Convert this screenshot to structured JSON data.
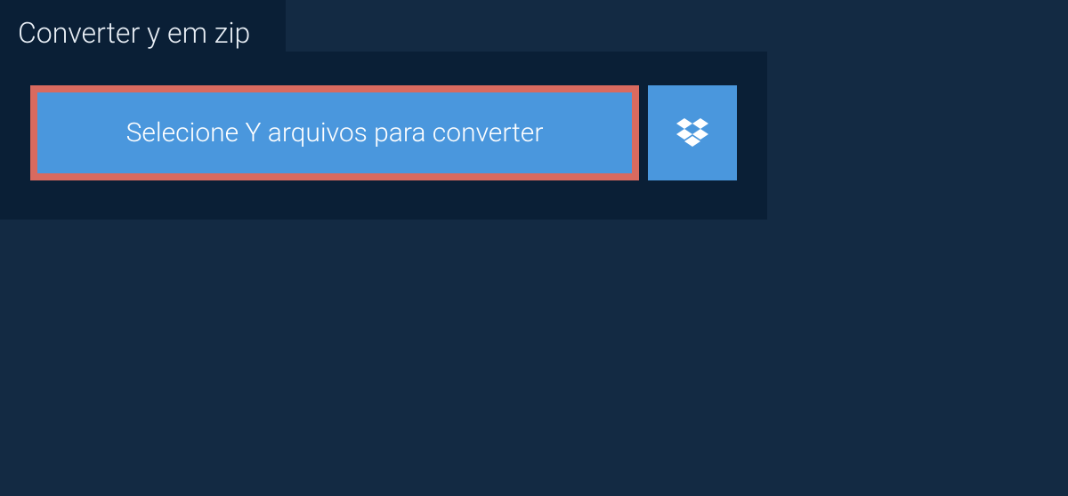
{
  "header": {
    "tab_label": "Converter y em zip"
  },
  "main": {
    "select_button_label": "Selecione Y arquivos para converter"
  },
  "colors": {
    "background": "#132a43",
    "panel": "#0a1f36",
    "button": "#4a97dd",
    "highlight_border": "#d96a5f",
    "text_light": "#e8eef5"
  }
}
